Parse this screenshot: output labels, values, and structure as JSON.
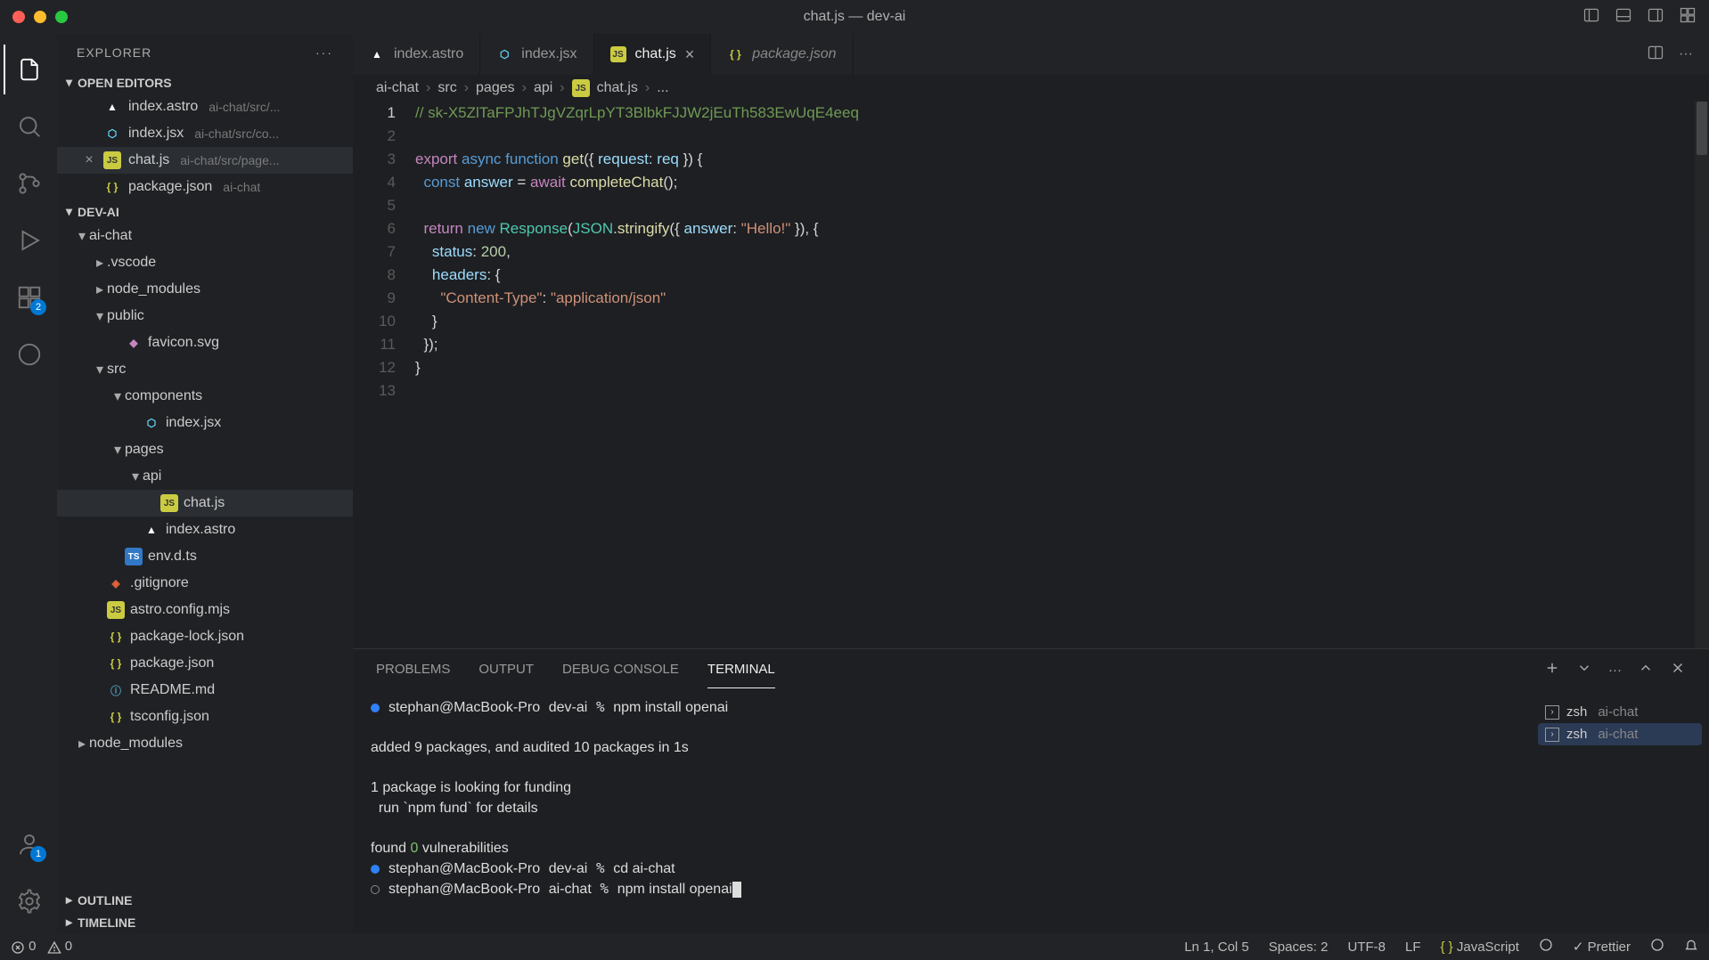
{
  "window": {
    "title": "chat.js — dev-ai"
  },
  "explorer": {
    "label": "EXPLORER",
    "openEditors": {
      "label": "OPEN EDITORS",
      "items": [
        {
          "icon": "astro",
          "name": "index.astro",
          "hint": "ai-chat/src/..."
        },
        {
          "icon": "jsx",
          "name": "index.jsx",
          "hint": "ai-chat/src/co..."
        },
        {
          "icon": "js",
          "name": "chat.js",
          "hint": "ai-chat/src/page...",
          "active": true,
          "closable": true
        },
        {
          "icon": "json",
          "name": "package.json",
          "hint": "ai-chat"
        }
      ]
    },
    "workspace": {
      "label": "DEV-AI"
    },
    "tree": [
      {
        "depth": 0,
        "type": "folder",
        "open": true,
        "name": "ai-chat"
      },
      {
        "depth": 1,
        "type": "folder",
        "open": false,
        "name": ".vscode"
      },
      {
        "depth": 1,
        "type": "folder",
        "open": false,
        "name": "node_modules"
      },
      {
        "depth": 1,
        "type": "folder",
        "open": true,
        "name": "public"
      },
      {
        "depth": 2,
        "type": "file",
        "icon": "svg",
        "name": "favicon.svg"
      },
      {
        "depth": 1,
        "type": "folder",
        "open": true,
        "name": "src"
      },
      {
        "depth": 2,
        "type": "folder",
        "open": true,
        "name": "components"
      },
      {
        "depth": 3,
        "type": "file",
        "icon": "jsx",
        "name": "index.jsx"
      },
      {
        "depth": 2,
        "type": "folder",
        "open": true,
        "name": "pages"
      },
      {
        "depth": 3,
        "type": "folder",
        "open": true,
        "name": "api"
      },
      {
        "depth": 4,
        "type": "file",
        "icon": "js",
        "name": "chat.js",
        "selected": true
      },
      {
        "depth": 3,
        "type": "file",
        "icon": "astro",
        "name": "index.astro"
      },
      {
        "depth": 2,
        "type": "file",
        "icon": "ts",
        "name": "env.d.ts"
      },
      {
        "depth": 1,
        "type": "file",
        "icon": "git",
        "name": ".gitignore"
      },
      {
        "depth": 1,
        "type": "file",
        "icon": "js",
        "name": "astro.config.mjs"
      },
      {
        "depth": 1,
        "type": "file",
        "icon": "json",
        "name": "package-lock.json"
      },
      {
        "depth": 1,
        "type": "file",
        "icon": "json",
        "name": "package.json"
      },
      {
        "depth": 1,
        "type": "file",
        "icon": "md",
        "name": "README.md"
      },
      {
        "depth": 1,
        "type": "file",
        "icon": "json",
        "name": "tsconfig.json"
      },
      {
        "depth": 0,
        "type": "folder",
        "open": false,
        "name": "node_modules"
      }
    ],
    "outline": "OUTLINE",
    "timeline": "TIMELINE"
  },
  "activity": {
    "badges": {
      "ext": "2",
      "accounts": "1"
    }
  },
  "tabs": [
    {
      "icon": "astro",
      "name": "index.astro"
    },
    {
      "icon": "jsx",
      "name": "index.jsx"
    },
    {
      "icon": "js",
      "name": "chat.js",
      "active": true,
      "closable": true
    },
    {
      "icon": "json",
      "name": "package.json",
      "italic": true
    }
  ],
  "breadcrumb": [
    "ai-chat",
    "src",
    "pages",
    "api",
    "chat.js",
    "..."
  ],
  "breadcrumbIcon": "js",
  "code": {
    "lines": 13,
    "current": 1,
    "l1": "// 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",
    "l3a": "export",
    "l3b": "async",
    "l3c": "function",
    "l3d": "get",
    "l3e": "({ ",
    "l3f": "request",
    "l3g": ":",
    "l3h": "req",
    "l3i": " })",
    "l3j": " {",
    "l4a": "const",
    "l4b": "answer",
    "l4c": " = ",
    "l4d": "await",
    "l4e": "completeChat",
    "l4f": "();",
    "l6a": "return",
    "l6b": "new",
    "l6c": "Response",
    "l6d": "(",
    "l6e": "JSON",
    "l6f": ".",
    "l6g": "stringify",
    "l6h": "({ ",
    "l6i": "answer",
    "l6j": ": ",
    "l6k": "\"Hello!\"",
    "l6l": " }), {",
    "l7a": "status",
    "l7b": ": ",
    "l7c": "200",
    "l7d": ",",
    "l8a": "headers",
    "l8b": ": {",
    "l9a": "\"Content-Type\"",
    "l9b": ": ",
    "l9c": "\"application/json\"",
    "l10": "}",
    "l11": "});",
    "l12": "}"
  },
  "panel": {
    "tabs": [
      "PROBLEMS",
      "OUTPUT",
      "DEBUG CONSOLE",
      "TERMINAL"
    ],
    "active": 3,
    "terminals": [
      {
        "name": "zsh",
        "hint": "ai-chat"
      },
      {
        "name": "zsh",
        "hint": "ai-chat",
        "active": true
      }
    ],
    "lines": {
      "p1user": "stephan@MacBook-Pro",
      "p1loc": "dev-ai",
      "p1cmd": "npm install openai",
      "out1": "added 9 packages, and audited 10 packages in 1s",
      "out2a": "1 package is looking for funding",
      "out2b": "  run `npm fund` for details",
      "out3a": "found ",
      "out3b": "0",
      "out3c": " vulnerabilities",
      "p2user": "stephan@MacBook-Pro",
      "p2loc": "dev-ai",
      "p2cmd": "cd ai-chat",
      "p3user": "stephan@MacBook-Pro",
      "p3loc": "ai-chat",
      "p3cmd": "npm install openai"
    }
  },
  "status": {
    "errors": "0",
    "warnings": "0",
    "ln": "Ln 1, Col 5",
    "spaces": "Spaces: 2",
    "enc": "UTF-8",
    "eol": "LF",
    "lang": "JavaScript",
    "prettier": "Prettier"
  }
}
